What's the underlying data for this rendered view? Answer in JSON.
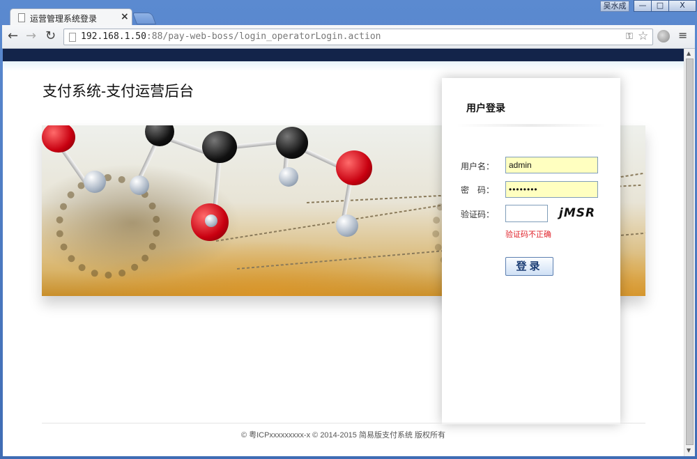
{
  "browser": {
    "user_badge": "吴水成",
    "min_label": "—",
    "max_label": "□",
    "close_label": "X",
    "tab": {
      "title": "运营管理系统登录",
      "close": "×"
    },
    "nav": {
      "back": "←",
      "forward": "→",
      "reload": "↻"
    },
    "url": {
      "host": "192.168.1.50",
      "rest": ":88/pay-web-boss/login_operatorLogin.action"
    },
    "icons": {
      "key": "key-icon",
      "star": "star-icon",
      "globe": "globe-icon",
      "menu": "menu-icon"
    }
  },
  "page": {
    "title": "支付系统-支付运营后台",
    "login": {
      "title": "用户登录",
      "username_label": "用户名：",
      "password_label": "密　码：",
      "captcha_label": "验证码：",
      "username_value": "admin",
      "password_value": "••••••••",
      "captcha_value": "",
      "captcha_text": "jMSR",
      "error_text": "验证码不正确",
      "submit_label": "登录"
    },
    "footer": "© 粤ICPxxxxxxxxx-x © 2014-2015 简易版支付系统 版权所有"
  },
  "colors": {
    "top_bar": "#13244a",
    "error": "#e0232b",
    "input_fill": "#ffffc0"
  }
}
